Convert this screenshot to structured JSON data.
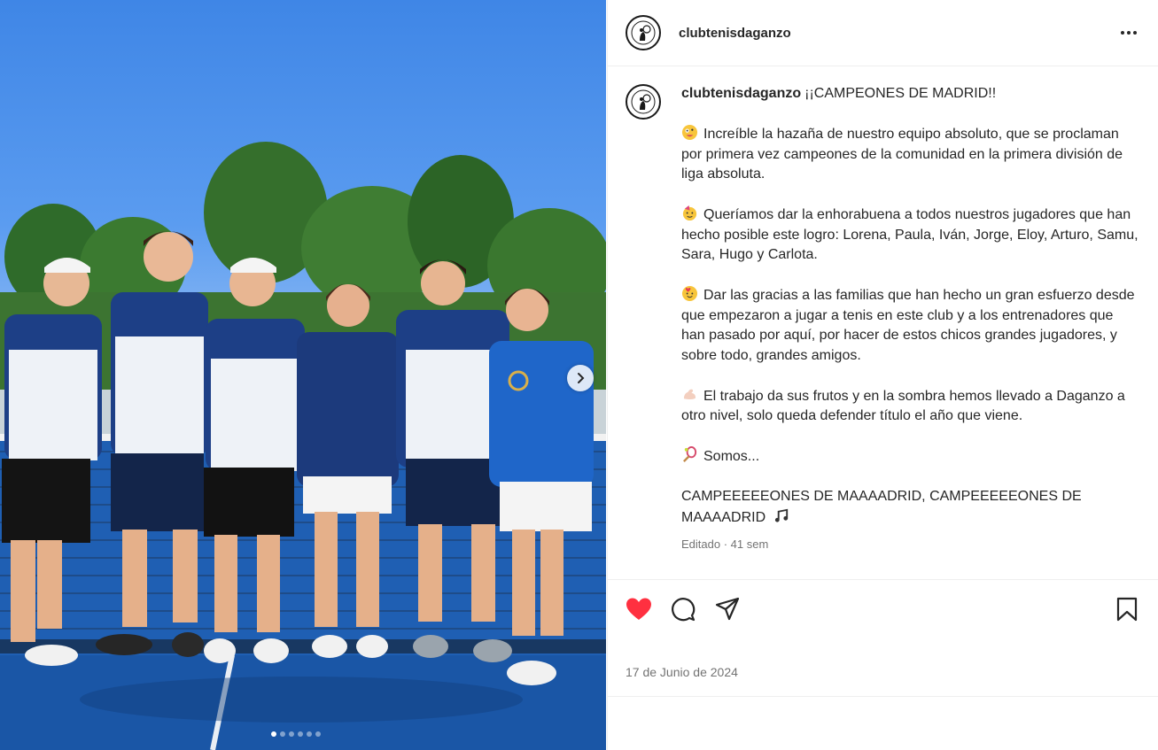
{
  "post": {
    "username": "clubtenisdaganzo",
    "caption_title": "¡¡CAMPEONES DE MADRID!!",
    "paragraphs": [
      {
        "emoji": "zany-face",
        "text": "Increíble la hazaña de nuestro equipo absoluto, que se proclaman por primera vez campeones de la comunidad en la primera división de liga absoluta."
      },
      {
        "emoji": "party-face",
        "text": "Queríamos dar la enhorabuena a todos nuestros jugadores que han hecho posible este logro: Lorena, Paula, Iván, Jorge, Eloy, Arturo, Samu, Sara, Hugo y Carlota."
      },
      {
        "emoji": "hearts-face",
        "text": "Dar las gracias a las familias que han hecho un gran esfuerzo desde que empezaron a jugar a tenis en este club y a los entrenadores que han pasado por aquí, por hacer de estos chicos grandes jugadores, y sobre todo, grandes amigos."
      },
      {
        "emoji": "flexed-biceps",
        "text": "El trabajo da sus frutos y en la sombra hemos llevado a Daganzo a otro nivel, solo queda defender título el año que viene."
      },
      {
        "emoji": "tennis-racket",
        "text": "Somos..."
      }
    ],
    "closing_line": "CAMPEEEEEONES DE MAAAADRID, CAMPEEEEEONES DE MAAAADRID",
    "closing_emoji": "music-notes",
    "meta": "Editado · 41 sem",
    "date": "17 de Junio de 2024"
  },
  "icons": {
    "more": "more-options-icon",
    "like": "heart-icon",
    "comment": "comment-icon",
    "share": "share-icon",
    "save": "bookmark-icon",
    "next": "chevron-right-icon"
  },
  "carousel": {
    "slides": 6,
    "active": 1
  },
  "colors": {
    "like_red": "#ff3040",
    "text": "#262626",
    "muted": "#737373",
    "divider": "#efefef"
  }
}
